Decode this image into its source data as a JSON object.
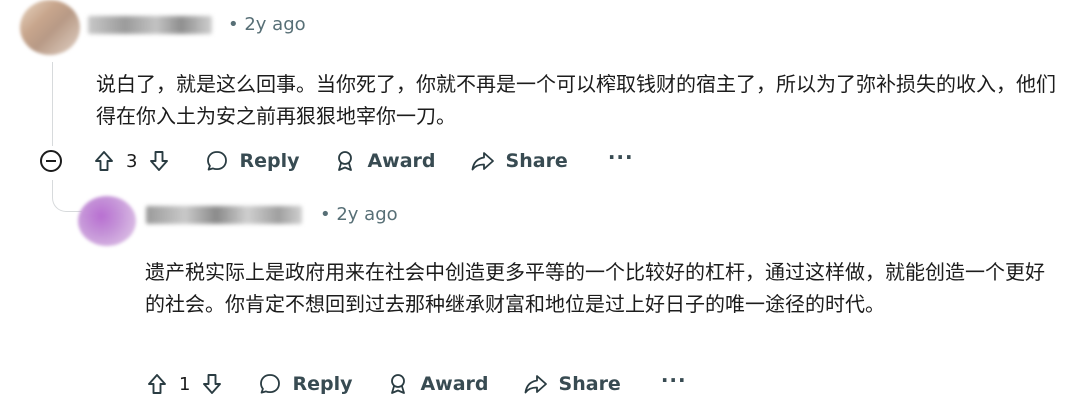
{
  "comments": [
    {
      "time": "• 2y ago",
      "body": "说白了，就是这么回事。当你死了，你就不再是一个可以榨取钱财的宿主了，所以为了弥补损失的收入，他们得在你入土为安之前再狠狠地宰你一刀。",
      "votes": "3",
      "reply_label": "Reply",
      "award_label": "Award",
      "share_label": "Share",
      "more_label": "···"
    },
    {
      "time": "• 2y ago",
      "body": "遗产税实际上是政府用来在社会中创造更多平等的一个比较好的杠杆，通过这样做，就能创造一个更好的社会。你肯定不想回到过去那种继承财富和地位是过上好日子的唯一途径的时代。",
      "votes": "1",
      "reply_label": "Reply",
      "award_label": "Award",
      "share_label": "Share",
      "more_label": "···"
    }
  ],
  "icons": {
    "upvote": "arrow-up-icon",
    "downvote": "arrow-down-icon",
    "reply": "speech-bubble-icon",
    "award": "award-ribbon-icon",
    "share": "share-arrow-icon",
    "collapse": "minus-circle-icon"
  },
  "colors": {
    "text": "#1c1c1c",
    "meta": "#576f76",
    "thread_line": "#d7dadc"
  }
}
